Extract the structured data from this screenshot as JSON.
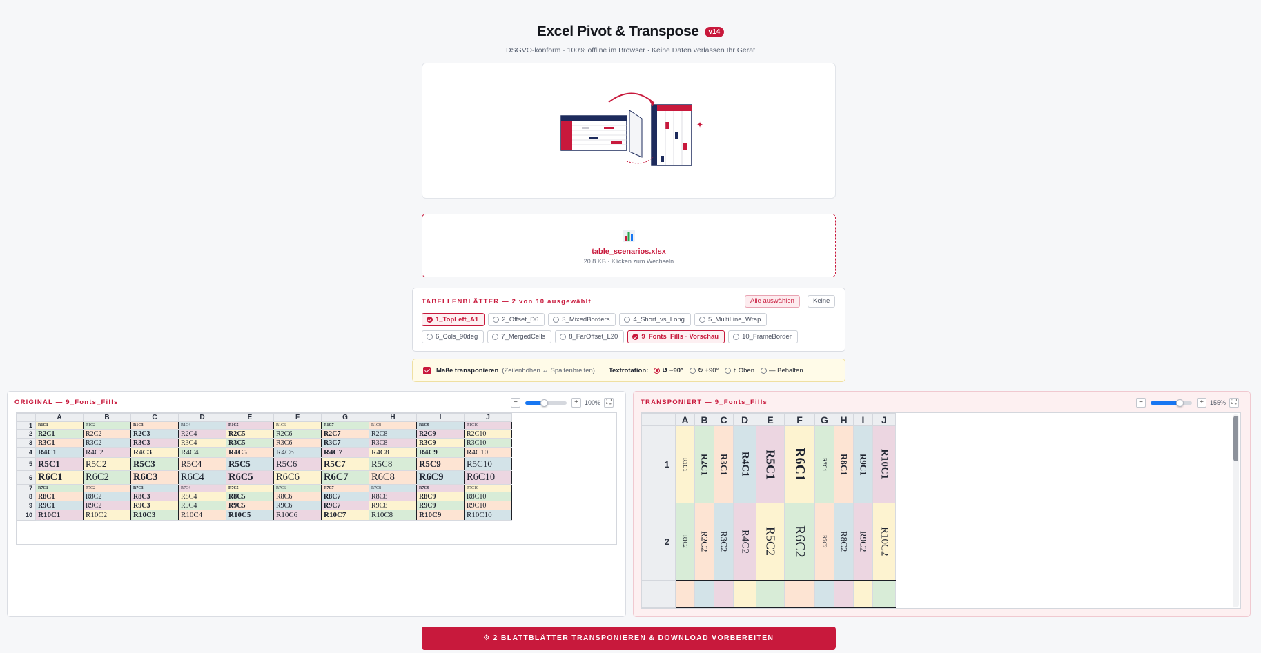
{
  "header": {
    "title": "Excel Pivot & Transpose",
    "version": "v14",
    "subtitle": "DSGVO-konform · 100% offline im Browser · Keine Daten verlassen Ihr Gerät"
  },
  "file": {
    "icon": "bar-chart-icon",
    "name": "table_scenarios.xlsx",
    "meta": "20.8 KB · Klicken zum Wechseln"
  },
  "sheets": {
    "title": "TABELLENBLÄTTER — 2 von 10 ausgewählt",
    "select_all": "Alle auswählen",
    "select_none": "Keine",
    "items": [
      {
        "label": "1_TopLeft_A1",
        "selected": true
      },
      {
        "label": "2_Offset_D6",
        "selected": false
      },
      {
        "label": "3_MixedBorders",
        "selected": false
      },
      {
        "label": "4_Short_vs_Long",
        "selected": false
      },
      {
        "label": "5_MultiLine_Wrap",
        "selected": false
      },
      {
        "label": "6_Cols_90deg",
        "selected": false
      },
      {
        "label": "7_MergedCells",
        "selected": false
      },
      {
        "label": "8_FarOffset_L20",
        "selected": false
      },
      {
        "label": "9_Fonts_Fills · Vorschau",
        "selected": true
      },
      {
        "label": "10_FrameBorder",
        "selected": false
      }
    ]
  },
  "options": {
    "transpose_dims_label": "Maße transponieren",
    "transpose_dims_hint": "(Zeilenhöhen ↔ Spaltenbreiten)",
    "transpose_dims_checked": true,
    "rotation_label": "Textrotation:",
    "rotation_options": [
      {
        "label": "↺ −90°",
        "selected": true
      },
      {
        "label": "↻ +90°",
        "selected": false
      },
      {
        "label": "↑ Oben",
        "selected": false
      },
      {
        "label": "— Behalten",
        "selected": false
      }
    ]
  },
  "original": {
    "title": "ORIGINAL — 9_Fonts_Fills",
    "zoom_label": "100%",
    "zoom_level": 0.45,
    "zoom_minus": "−",
    "zoom_plus": "+",
    "fullscreen_icon": "expand-icon",
    "columns": [
      "A",
      "B",
      "C",
      "D",
      "E",
      "F",
      "G",
      "H",
      "I",
      "J"
    ],
    "row_numbers": [
      "1",
      "2",
      "3",
      "4",
      "5",
      "6",
      "7",
      "8",
      "9",
      "10"
    ]
  },
  "transposed": {
    "title": "TRANSPONIERT — 9_Fonts_Fills",
    "zoom_label": "155%",
    "zoom_level": 0.7,
    "zoom_minus": "−",
    "zoom_plus": "+",
    "fullscreen_icon": "expand-icon",
    "columns": [
      "A",
      "B",
      "C",
      "D",
      "E",
      "F",
      "G",
      "H",
      "I",
      "J"
    ],
    "row_numbers": [
      "1",
      "2"
    ]
  },
  "row_styles": [
    {
      "size": "tiny",
      "bold": true
    },
    {
      "size": "normal",
      "bold": true
    },
    {
      "size": "normal",
      "bold": true
    },
    {
      "size": "medium",
      "bold": true
    },
    {
      "size": "large",
      "bold": true
    },
    {
      "size": "xlarge",
      "bold": true
    },
    {
      "size": "tiny",
      "bold": true
    },
    {
      "size": "normal",
      "bold": true
    },
    {
      "size": "normal",
      "bold": true
    },
    {
      "size": "medium",
      "bold": true
    }
  ],
  "fill_colors": [
    "#fdf3d0",
    "#d8ecd7",
    "#fde4d3",
    "#d3e3e8",
    "#ecd6e1"
  ],
  "cta": {
    "label": "⟐ 2 BLATTBLÄTTER TRANSPONIEREN & DOWNLOAD VORBEREITEN"
  }
}
